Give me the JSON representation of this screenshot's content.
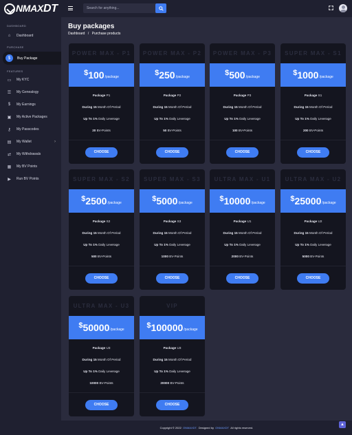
{
  "brand": {
    "logo_text": "NMAX",
    "logo_suffix": "DT"
  },
  "topbar": {
    "search_placeholder": "Search for anything..."
  },
  "sidebar": {
    "sections": {
      "dashboard": "DASHBOARD",
      "purchase": "PURCHASE",
      "features": "FEATURES"
    },
    "items": [
      {
        "label": "Dashboard",
        "icon": "dashboard-icon"
      },
      {
        "label": "Buy Package",
        "icon": "dollar-icon",
        "active": true
      },
      {
        "label": "My KYC",
        "icon": "id-card-icon"
      },
      {
        "label": "My Genealogy",
        "icon": "list-icon"
      },
      {
        "label": "My Earnings",
        "icon": "dollar-icon"
      },
      {
        "label": "My Active Packages",
        "icon": "box-icon"
      },
      {
        "label": "My Passcodes",
        "icon": "key-icon"
      },
      {
        "label": "My Wallet",
        "icon": "wallet-icon"
      },
      {
        "label": "My Withdrawals",
        "icon": "withdraw-icon"
      },
      {
        "label": "My BV Points",
        "icon": "points-icon"
      },
      {
        "label": "Run BV Points",
        "icon": "run-icon"
      }
    ]
  },
  "page": {
    "title": "Buy packages",
    "crumb_home": "Dashboard",
    "crumb_sep": "/",
    "crumb_current": "Purchase products"
  },
  "common": {
    "price_suffix": "/package",
    "currency": "$",
    "package_word": "Package",
    "during_prefix": "During",
    "during_number": "15",
    "during_suffix": "Month Of Period",
    "upto_prefix": "Up To",
    "upto_number": "1%",
    "upto_suffix": "Daily Leverage",
    "bv_suffix": "BV-Points",
    "choose_label": "CHOOSE"
  },
  "packages": [
    {
      "name": "POWER MAX - P1",
      "price": "100",
      "code": "P1",
      "bv": "20"
    },
    {
      "name": "POWER MAX - P2",
      "price": "250",
      "code": "P2",
      "bv": "50"
    },
    {
      "name": "POWER MAX - P3",
      "price": "500",
      "code": "P3",
      "bv": "100"
    },
    {
      "name": "SUPER MAX - S1",
      "price": "1000",
      "code": "S1",
      "bv": "200"
    },
    {
      "name": "SUPER MAX - S2",
      "price": "2500",
      "code": "S2",
      "bv": "500"
    },
    {
      "name": "SUPER MAX - S3",
      "price": "5000",
      "code": "S3",
      "bv": "1000"
    },
    {
      "name": "ULTRA MAX - U1",
      "price": "10000",
      "code": "U1",
      "bv": "2000"
    },
    {
      "name": "ULTRA MAX - U2",
      "price": "25000",
      "code": "U2",
      "bv": "5000"
    },
    {
      "name": "ULTRA MAX - U3",
      "price": "50000",
      "code": "U3",
      "bv": "10000"
    },
    {
      "name": "VIP",
      "price": "100000",
      "code": "U3",
      "bv": "20000"
    }
  ],
  "footer": {
    "prefix": "Copyright © 2022",
    "brand1": "ONMAXDT.",
    "middle": "Designed by",
    "brand2": "ONMAXDT",
    "suffix": "All rights reserved."
  },
  "colors": {
    "accent": "#3f7cf2",
    "sidebar_bg": "#1f2030",
    "page_bg": "#2a2b3d",
    "card_bg": "#14151f"
  }
}
